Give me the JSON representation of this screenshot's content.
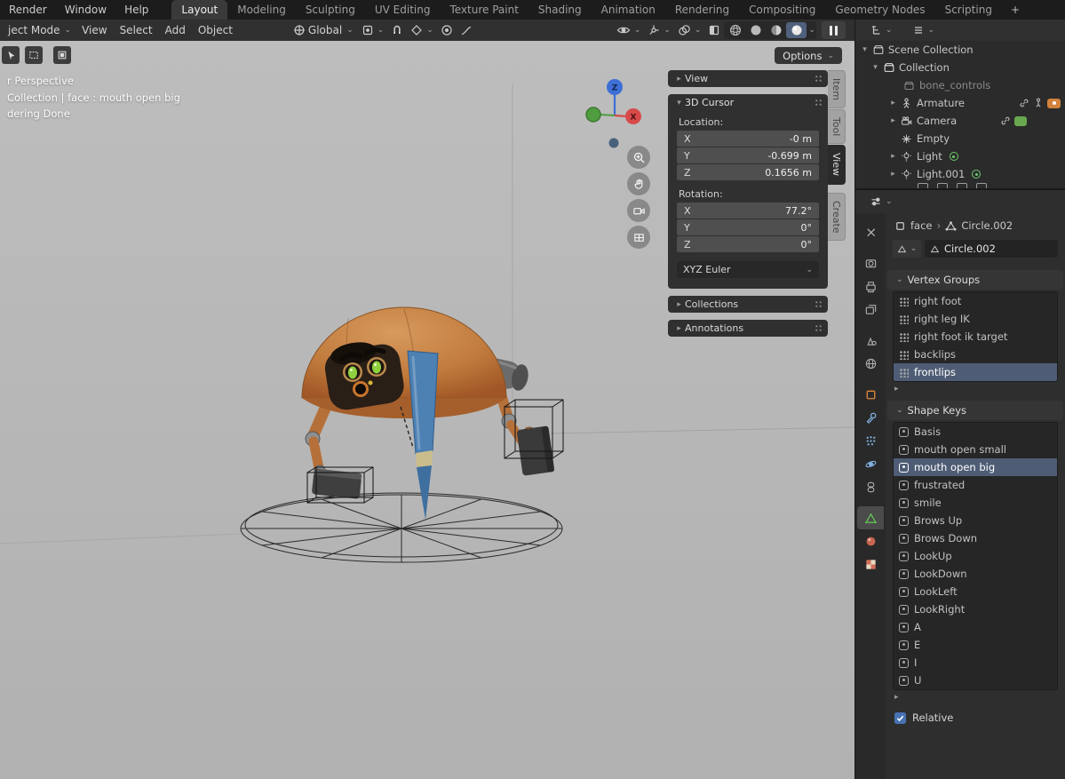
{
  "topbar": {
    "menus": [
      "Render",
      "Window",
      "Help"
    ],
    "workspaces": [
      "Layout",
      "Modeling",
      "Sculpting",
      "UV Editing",
      "Texture Paint",
      "Shading",
      "Animation",
      "Rendering",
      "Compositing",
      "Geometry Nodes",
      "Scripting"
    ],
    "active_workspace": "Layout",
    "add_workspace": "+"
  },
  "viewport_header": {
    "mode": "ject Mode",
    "menus": [
      "View",
      "Select",
      "Add",
      "Object"
    ],
    "orientation": "Global",
    "options": "Options"
  },
  "viewport": {
    "overlay": [
      "r Perspective",
      "Collection | face : mouth open big",
      "dering Done"
    ],
    "gizmo": {
      "z": "Z",
      "x": "X"
    }
  },
  "npanel": {
    "tabs": [
      "Item",
      "Tool",
      "View",
      "Create"
    ],
    "active_tab": "View",
    "view_panel": "View",
    "cursor_panel": "3D Cursor",
    "collections_panel": "Collections",
    "annotations_panel": "Annotations",
    "location_label": "Location:",
    "rotation_label": "Rotation:",
    "location": [
      {
        "axis": "X",
        "value": "-0 m"
      },
      {
        "axis": "Y",
        "value": "-0.699 m"
      },
      {
        "axis": "Z",
        "value": "0.1656 m"
      }
    ],
    "rotation": [
      {
        "axis": "X",
        "value": "77.2°"
      },
      {
        "axis": "Y",
        "value": "0°"
      },
      {
        "axis": "Z",
        "value": "0°"
      }
    ],
    "rotation_mode": "XYZ Euler"
  },
  "outliner": {
    "rows": [
      {
        "label": "Scene Collection"
      },
      {
        "label": "Collection"
      },
      {
        "label": "bone_controls"
      },
      {
        "label": "Armature"
      },
      {
        "label": "Camera"
      },
      {
        "label": "Empty"
      },
      {
        "label": "Light"
      },
      {
        "label": "Light.001"
      }
    ]
  },
  "properties": {
    "breadcrumb": {
      "object": "face",
      "data": "Circle.002"
    },
    "name_value": "Circle.002",
    "vertex_groups": {
      "title": "Vertex Groups",
      "items": [
        "right foot",
        "right leg IK",
        "right foot ik target",
        "backlips",
        "frontlips"
      ],
      "active": "frontlips"
    },
    "shape_keys": {
      "title": "Shape Keys",
      "items": [
        "Basis",
        "mouth open small",
        "mouth open big",
        "frustrated",
        "smile",
        "Brows Up",
        "Brows Down",
        "LookUp",
        "LookDown",
        "LookLeft",
        "LookRight",
        "A",
        "E",
        "I",
        "U"
      ],
      "active": "mouth open big"
    },
    "relative_label": "Relative"
  },
  "icons": {
    "chevron_down": "⌄",
    "collapse_right": "▸",
    "collapse_down": "▾",
    "crumb_sep": "›",
    "list_expand": "▸"
  },
  "colors": {
    "accent_blue": "#4772b3",
    "selection_row": "#4e5d75",
    "object_orange": "#d2823c",
    "viewport_bg": "#b7b7b7"
  }
}
